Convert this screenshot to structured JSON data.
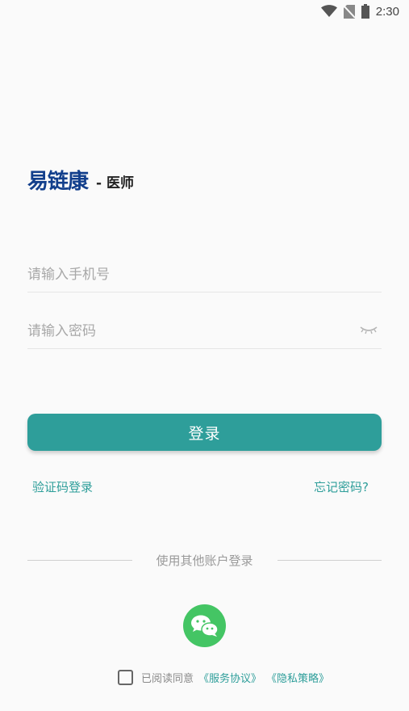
{
  "status_bar": {
    "time": "2:30"
  },
  "logo": {
    "brand": "易链康",
    "role": "- 医师"
  },
  "form": {
    "phone_placeholder": "请输入手机号",
    "password_placeholder": "请输入密码"
  },
  "login_button_label": "登录",
  "links": {
    "sms_login": "验证码登录",
    "forgot_password": "忘记密码?"
  },
  "other_login": {
    "label": "使用其他账户登录"
  },
  "agreement": {
    "prefix": "已阅读同意",
    "service": "《服务协议》",
    "privacy": "《隐私策略》"
  },
  "colors": {
    "accent": "#2e9e9a",
    "brand": "#123f8c",
    "wechat": "#44c564"
  }
}
